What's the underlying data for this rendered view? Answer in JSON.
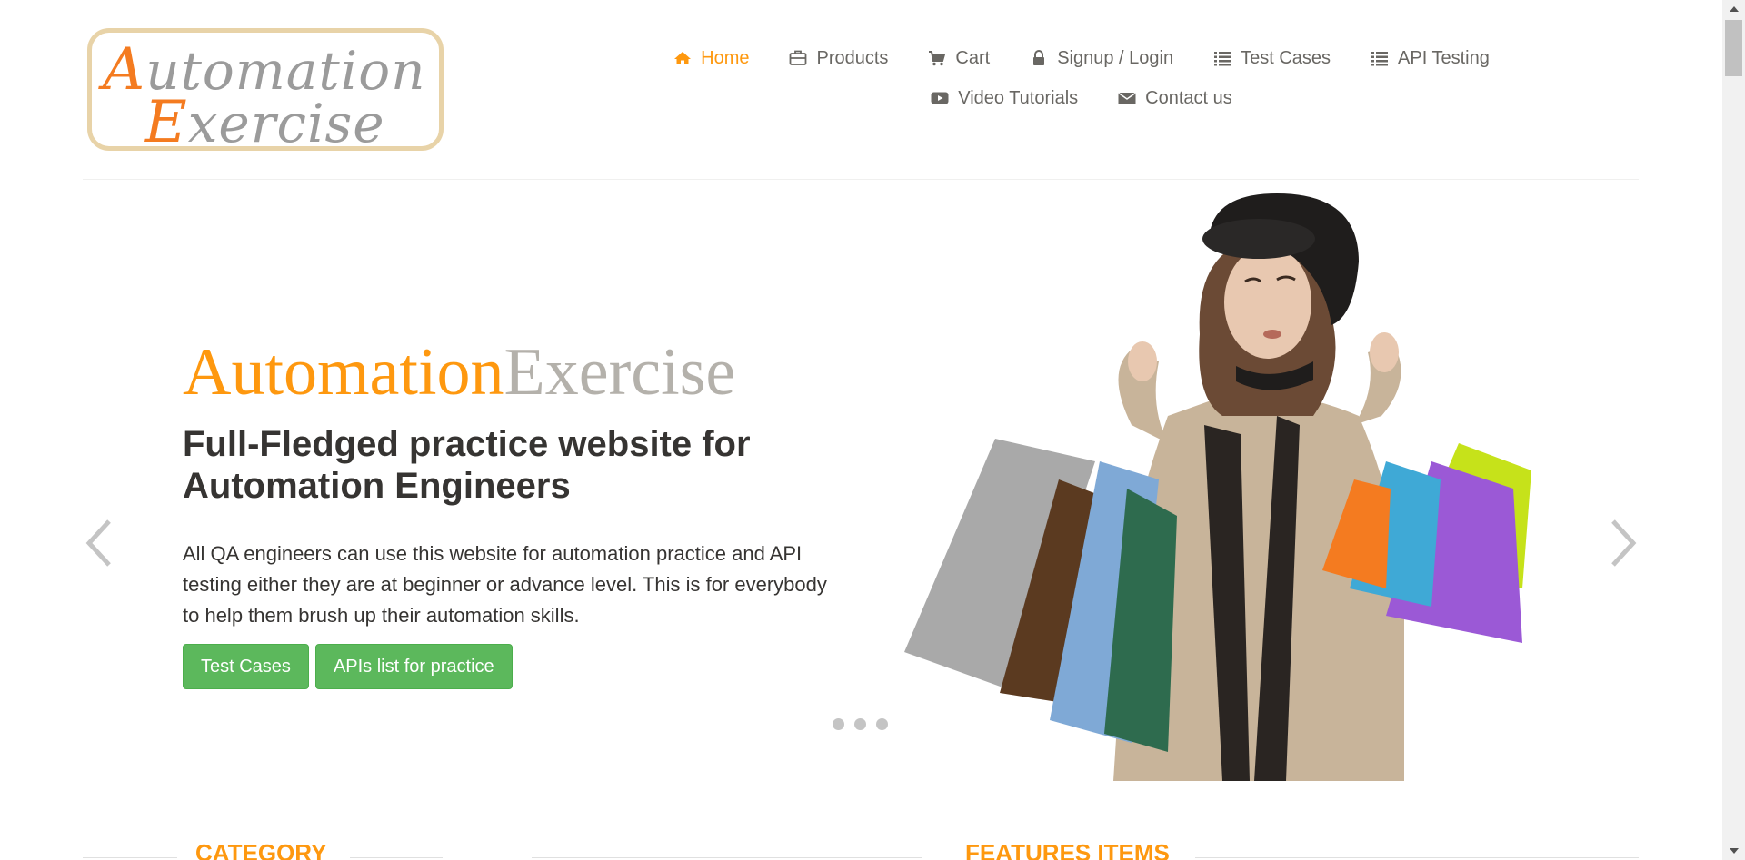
{
  "header": {
    "logo_text": "Automation Exercise",
    "logo_line1_cap": "A",
    "logo_line1_rest": "utomation",
    "logo_line2_cap": "E",
    "logo_line2_rest": "xercise",
    "nav": [
      {
        "label": "Home",
        "icon": "home-icon",
        "active": true
      },
      {
        "label": "Products",
        "icon": "briefcase-icon"
      },
      {
        "label": "Cart",
        "icon": "cart-icon"
      },
      {
        "label": "Signup / Login",
        "icon": "lock-icon"
      },
      {
        "label": "Test Cases",
        "icon": "list-icon"
      },
      {
        "label": "API Testing",
        "icon": "list-icon"
      },
      {
        "label": "Video Tutorials",
        "icon": "youtube-play-icon"
      },
      {
        "label": "Contact us",
        "icon": "envelope-icon"
      }
    ]
  },
  "slider": {
    "brand_part1": "Automation",
    "brand_part2": "Exercise",
    "headline": "Full-Fledged practice website for Automation Engineers",
    "description": "All QA engineers can use this website for automation practice and API testing either they are at beginner or advance level. This is for everybody to help them brush up their automation skills.",
    "btn_test_cases": "Test Cases",
    "btn_apis": "APIs list for practice",
    "slide_count": 3,
    "active_slide": 1
  },
  "sections": {
    "category": "CATEGORY",
    "features": "FEATURES ITEMS"
  },
  "colors": {
    "accent": "#fe980f",
    "button_green": "#5cb85c",
    "text_dark": "#363432",
    "text_muted": "#696763"
  }
}
